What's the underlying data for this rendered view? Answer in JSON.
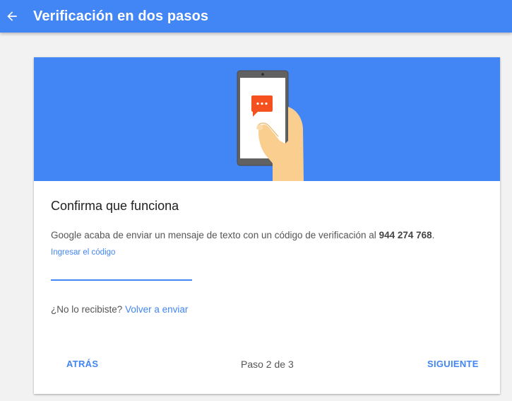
{
  "header": {
    "title": "Verificación en dos pasos",
    "back_icon": "arrow-back-icon"
  },
  "colors": {
    "brand_blue": "#4285f4",
    "chat_orange": "#f4511e",
    "background": "#f2f2f2"
  },
  "hero": {
    "icons": [
      "phone-illustration",
      "chat-bubble-icon",
      "hand-illustration"
    ]
  },
  "card": {
    "title": "Confirma que funciona",
    "message": "Google acaba de enviar un mensaje de texto con un código de verificación al",
    "phone_number": "944 274 768",
    "message_end": ".",
    "code_label": "Ingresar el código",
    "code_value": "",
    "resend_question": "¿No lo recibiste?",
    "resend_link": "Volver a enviar"
  },
  "footer": {
    "back_label": "ATRÁS",
    "step_text": "Paso 2 de 3",
    "next_label": "SIGUIENTE"
  }
}
